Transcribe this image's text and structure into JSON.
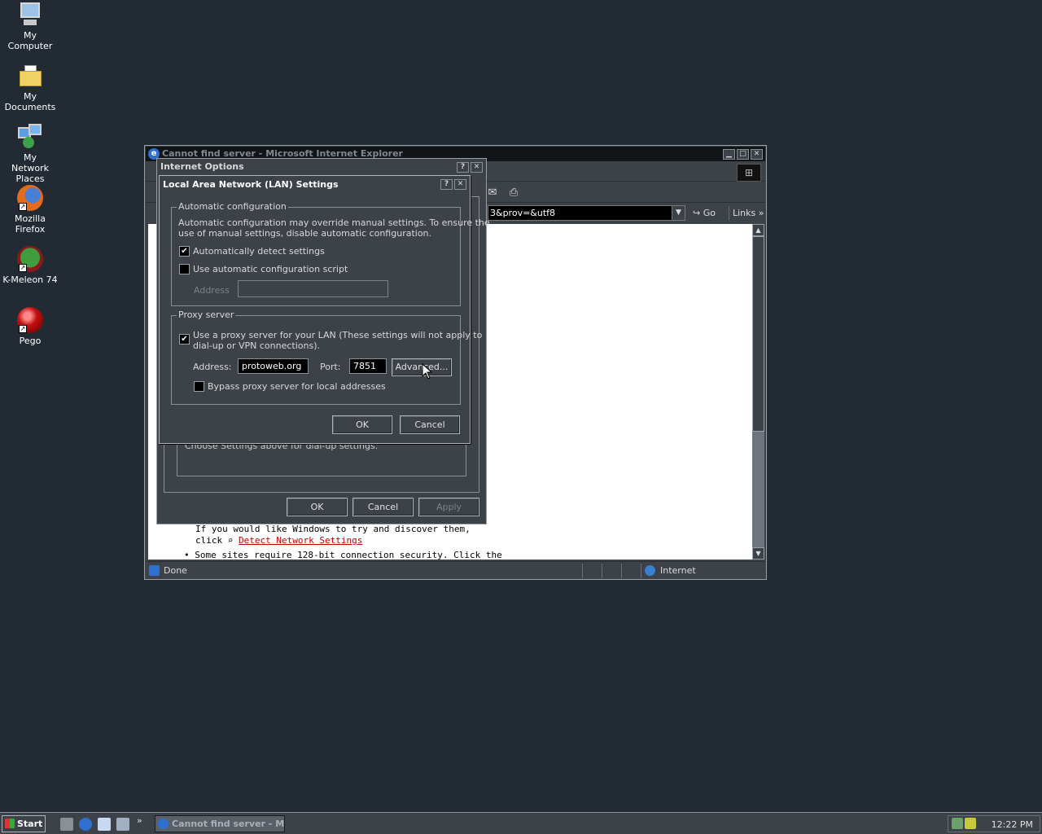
{
  "desktop": {
    "icons": [
      {
        "label": "My Computer"
      },
      {
        "label": "My Documents"
      },
      {
        "label": "My Network Places"
      },
      {
        "label": "Mozilla Firefox"
      },
      {
        "label": "K-Meleon 74"
      },
      {
        "label": "Pego"
      }
    ]
  },
  "ie": {
    "title": "Cannot find server - Microsoft Internet Explorer",
    "address_text": "3&prov=&utf8",
    "go_label": "Go",
    "links_label": "Links",
    "content": {
      "line1": "If you would like Windows to try and discover them,",
      "line2_prefix": "click",
      "line2_link": "Detect Network Settings",
      "line3": "Some sites require 128-bit connection security. Click the"
    },
    "status": {
      "text": "Done",
      "zone": "Internet"
    }
  },
  "internet_options": {
    "title": "Internet Options",
    "hint": "Choose Settings above for dial-up settings.",
    "ok_label": "OK",
    "cancel_label": "Cancel",
    "apply_label": "Apply"
  },
  "lan_settings": {
    "title": "Local Area Network (LAN) Settings",
    "auto_config": {
      "legend": "Automatic configuration",
      "description_line1": "Automatic configuration may override manual settings.  To ensure the",
      "description_line2": "use of manual settings, disable automatic configuration.",
      "auto_detect_label": "Automatically detect settings",
      "auto_detect_checked": true,
      "script_label": "Use automatic configuration script",
      "script_checked": false,
      "address_label": "Address",
      "address_value": ""
    },
    "proxy": {
      "legend": "Proxy server",
      "use_proxy_line1": "Use a proxy server for your LAN (These settings will not apply to",
      "use_proxy_line2": "dial-up or VPN connections).",
      "use_proxy_checked": true,
      "address_label": "Address:",
      "address_value": "protoweb.org",
      "port_label": "Port:",
      "port_value": "7851",
      "advanced_label": "Advanced...",
      "bypass_label": "Bypass proxy server for local addresses",
      "bypass_checked": false
    },
    "ok_label": "OK",
    "cancel_label": "Cancel"
  },
  "taskbar": {
    "start_label": "Start",
    "task_label": "Cannot find server - M...",
    "clock": "12:22 PM"
  }
}
